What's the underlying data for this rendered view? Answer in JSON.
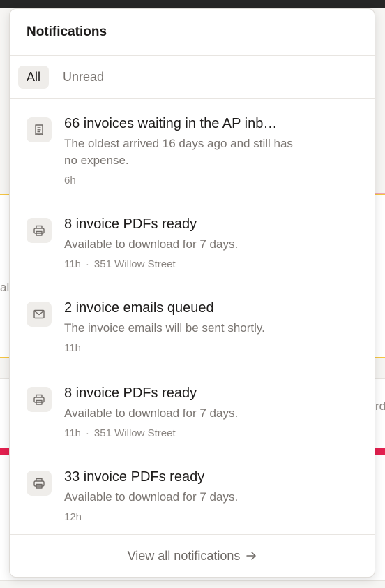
{
  "panel": {
    "title": "Notifications",
    "tabs": [
      {
        "label": "All",
        "active": true
      },
      {
        "label": "Unread",
        "active": false
      }
    ]
  },
  "notifications": [
    {
      "icon": "receipt-icon",
      "title": "66 invoices waiting in the AP inb…",
      "description": "The oldest arrived 16 days ago and still has no expense.",
      "time": "6h",
      "location": ""
    },
    {
      "icon": "printer-icon",
      "title": "8 invoice PDFs ready",
      "description": "Available to download for 7 days.",
      "time": "11h",
      "location": "351 Willow Street"
    },
    {
      "icon": "mail-icon",
      "title": "2 invoice emails queued",
      "description": "The invoice emails will be sent shortly.",
      "time": "11h",
      "location": ""
    },
    {
      "icon": "printer-icon",
      "title": "8 invoice PDFs ready",
      "description": "Available to download for 7 days.",
      "time": "11h",
      "location": "351 Willow Street"
    },
    {
      "icon": "printer-icon",
      "title": "33 invoice PDFs ready",
      "description": "Available to download for 7 days.",
      "time": "12h",
      "location": ""
    }
  ],
  "footer": {
    "view_all_label": "View all notifications"
  },
  "background": {
    "left_fragment": "ala",
    "right_fragment": "rd"
  },
  "colors": {
    "accent_yellow": "#f5c542",
    "accent_pink": "#f2a7b5",
    "accent_red": "#e3204f"
  }
}
